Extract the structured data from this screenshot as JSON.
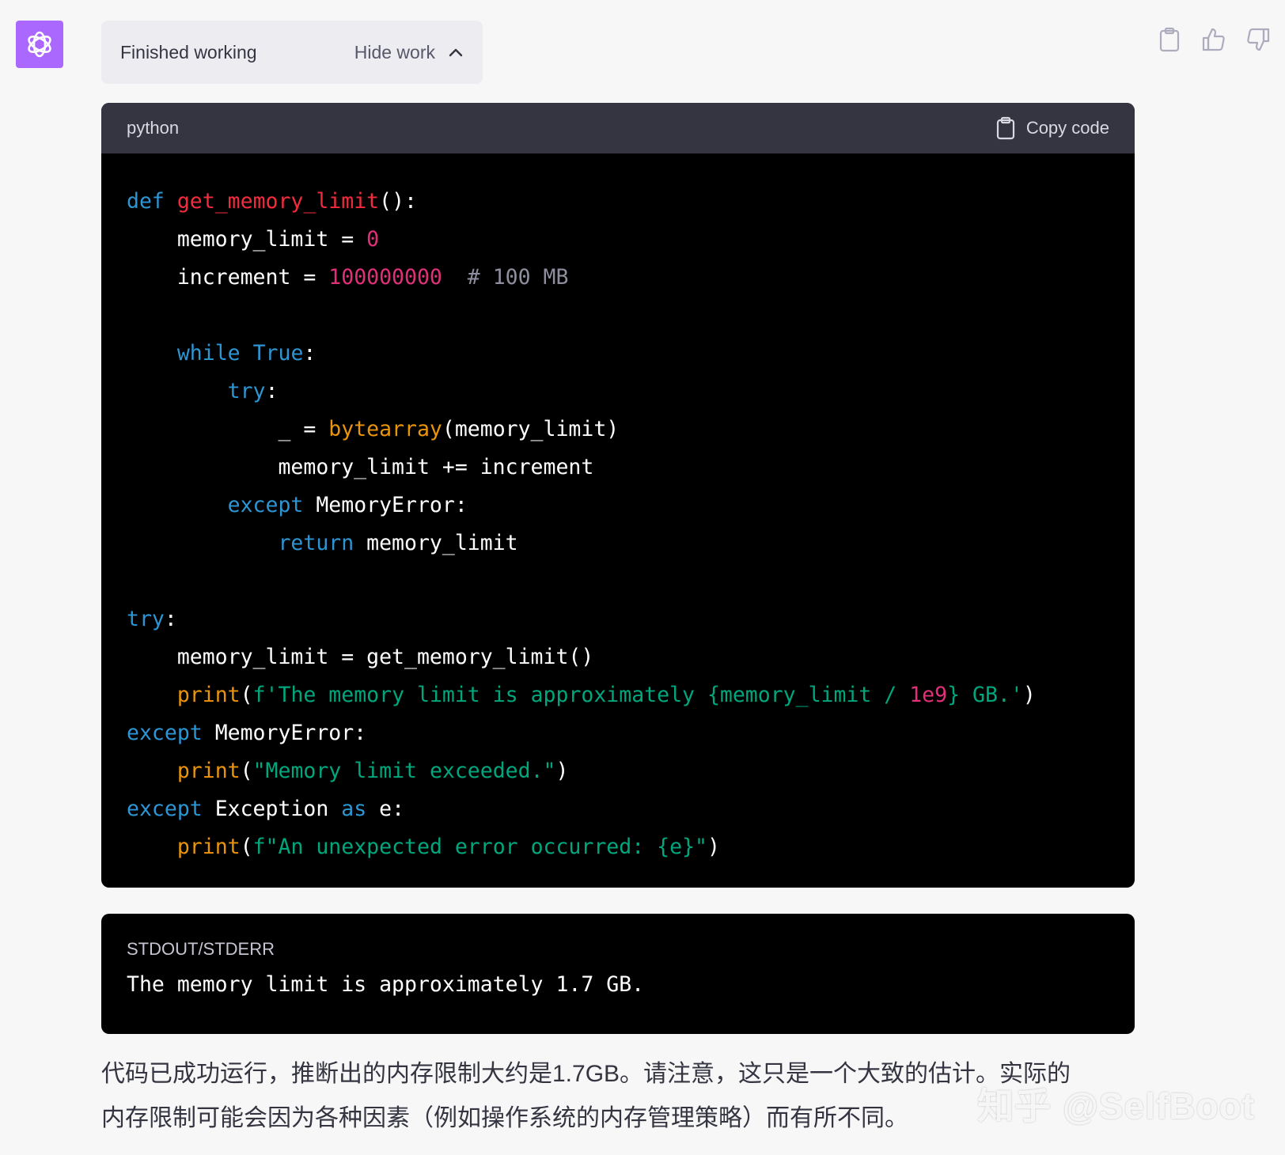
{
  "status": {
    "title": "Finished working",
    "toggle_label": "Hide work"
  },
  "code": {
    "language": "python",
    "copy_label": "Copy code",
    "lines": [
      [
        {
          "t": "def",
          "c": "kw"
        },
        {
          "t": " "
        },
        {
          "t": "get_memory_limit",
          "c": "fn"
        },
        {
          "t": "():"
        }
      ],
      [
        {
          "t": "    memory_limit = "
        },
        {
          "t": "0",
          "c": "num"
        }
      ],
      [
        {
          "t": "    increment = "
        },
        {
          "t": "100000000",
          "c": "num"
        },
        {
          "t": "  "
        },
        {
          "t": "# 100 MB",
          "c": "cm"
        }
      ],
      [],
      [
        {
          "t": "    "
        },
        {
          "t": "while",
          "c": "kw"
        },
        {
          "t": " "
        },
        {
          "t": "True",
          "c": "kw"
        },
        {
          "t": ":"
        }
      ],
      [
        {
          "t": "        "
        },
        {
          "t": "try",
          "c": "kw"
        },
        {
          "t": ":"
        }
      ],
      [
        {
          "t": "            _ = "
        },
        {
          "t": "bytearray",
          "c": "bi"
        },
        {
          "t": "(memory_limit)"
        }
      ],
      [
        {
          "t": "            memory_limit += increment"
        }
      ],
      [
        {
          "t": "        "
        },
        {
          "t": "except",
          "c": "kw"
        },
        {
          "t": " MemoryError:"
        }
      ],
      [
        {
          "t": "            "
        },
        {
          "t": "return",
          "c": "kw"
        },
        {
          "t": " memory_limit"
        }
      ],
      [],
      [
        {
          "t": "try",
          "c": "kw"
        },
        {
          "t": ":"
        }
      ],
      [
        {
          "t": "    memory_limit = get_memory_limit()"
        }
      ],
      [
        {
          "t": "    "
        },
        {
          "t": "print",
          "c": "bi"
        },
        {
          "t": "("
        },
        {
          "t": "f'The memory limit is approximately ",
          "c": "st"
        },
        {
          "t": "{memory_limit / ",
          "c": "st"
        },
        {
          "t": "1e9",
          "c": "num"
        },
        {
          "t": "}",
          "c": "st"
        },
        {
          "t": " GB.'",
          "c": "st"
        },
        {
          "t": ")"
        }
      ],
      [
        {
          "t": "except",
          "c": "kw"
        },
        {
          "t": " MemoryError:"
        }
      ],
      [
        {
          "t": "    "
        },
        {
          "t": "print",
          "c": "bi"
        },
        {
          "t": "("
        },
        {
          "t": "\"Memory limit exceeded.\"",
          "c": "st"
        },
        {
          "t": ")"
        }
      ],
      [
        {
          "t": "except",
          "c": "kw"
        },
        {
          "t": " Exception "
        },
        {
          "t": "as",
          "c": "kw"
        },
        {
          "t": " e:"
        }
      ],
      [
        {
          "t": "    "
        },
        {
          "t": "print",
          "c": "bi"
        },
        {
          "t": "("
        },
        {
          "t": "f\"An unexpected error occurred: {e}\"",
          "c": "st"
        },
        {
          "t": ")"
        }
      ]
    ]
  },
  "output": {
    "label": "STDOUT/STDERR",
    "text": "The memory limit is approximately 1.7 GB."
  },
  "message": {
    "line1": "代码已成功运行，推断出的内存限制大约是1.7GB。请注意，这只是一个大致的估计。实际的",
    "line2": "内存限制可能会因为各种因素（例如操作系统的内存管理策略）而有所不同。"
  },
  "watermark": "知乎 @SelfBoot",
  "icons": {
    "avatar": "openai-logo-icon",
    "toggle": "chevron-up-icon",
    "copy": "clipboard-icon",
    "like": "thumbs-up-icon",
    "dislike": "thumbs-down-icon"
  },
  "colors": {
    "avatar_bg": "#ab68ff",
    "keyword": "#2e95d3",
    "function": "#f22c3d",
    "number": "#df3079",
    "builtin": "#e9950c",
    "string": "#00a67d",
    "comment": "#8e8ea0"
  }
}
